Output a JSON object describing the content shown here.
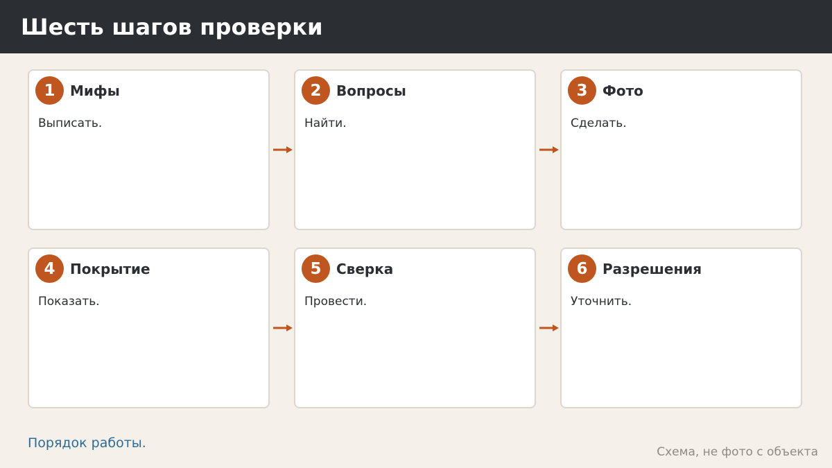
{
  "header": {
    "title": "Шесть шагов проверки"
  },
  "steps": [
    {
      "number": "1",
      "title": "Мифы",
      "text": "Выписать."
    },
    {
      "number": "2",
      "title": "Вопросы",
      "text": "Найти."
    },
    {
      "number": "3",
      "title": "Фото",
      "text": "Сделать."
    },
    {
      "number": "4",
      "title": "Покрытие",
      "text": "Показать."
    },
    {
      "number": "5",
      "title": "Сверка",
      "text": "Провести."
    },
    {
      "number": "6",
      "title": "Разрешения",
      "text": "Уточнить."
    }
  ],
  "footer": {
    "left": "Порядок работы.",
    "right": "Схема, не фото с объекта"
  },
  "colors": {
    "header_bg": "#2b2e33",
    "accent": "#c0561f",
    "link": "#2f6a94",
    "background": "#f5f1ea"
  },
  "icons": {
    "connector": "arrow-right-icon"
  }
}
